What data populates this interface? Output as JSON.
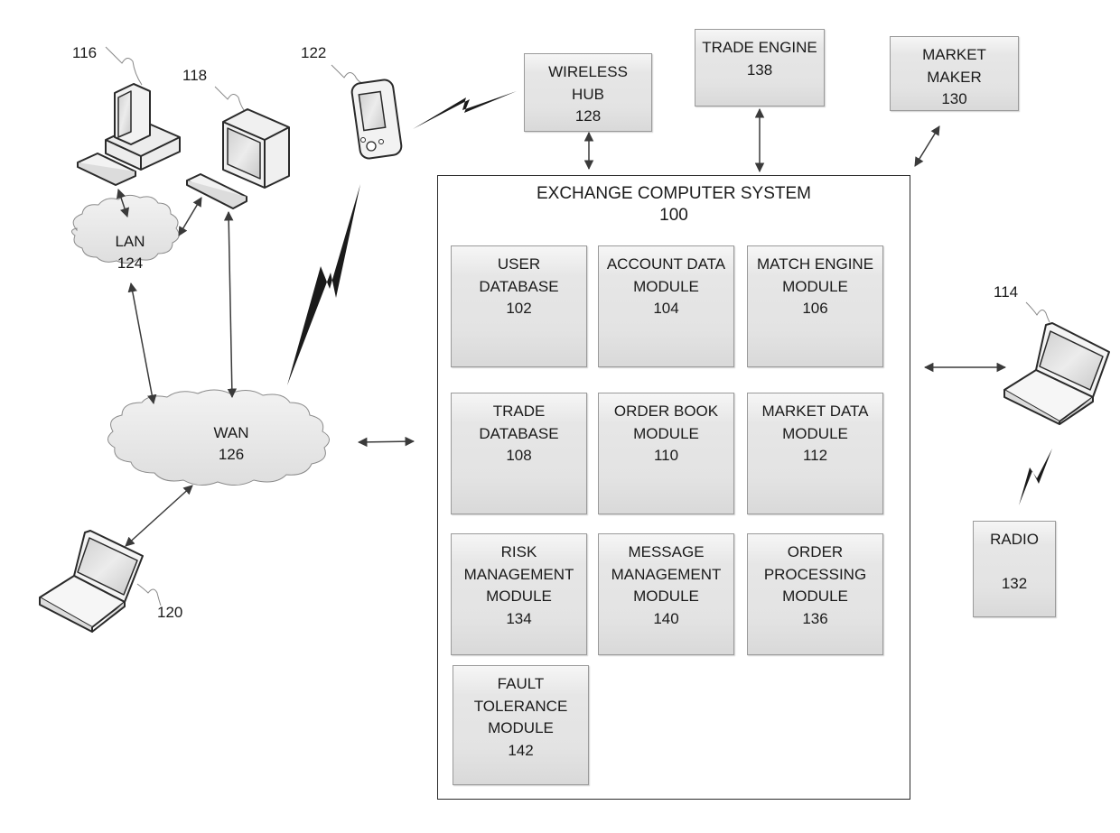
{
  "exchange": {
    "title": "EXCHANGE COMPUTER SYSTEM",
    "ref": "100",
    "modules": [
      {
        "lines": [
          "USER",
          "DATABASE"
        ],
        "ref": "102"
      },
      {
        "lines": [
          "ACCOUNT DATA",
          "MODULE"
        ],
        "ref": "104"
      },
      {
        "lines": [
          "MATCH ENGINE",
          "MODULE"
        ],
        "ref": "106"
      },
      {
        "lines": [
          "TRADE",
          "DATABASE"
        ],
        "ref": "108"
      },
      {
        "lines": [
          "ORDER BOOK",
          "MODULE"
        ],
        "ref": "110"
      },
      {
        "lines": [
          "MARKET DATA",
          "MODULE"
        ],
        "ref": "112"
      },
      {
        "lines": [
          "RISK",
          "MANAGEMENT",
          "MODULE"
        ],
        "ref": "134"
      },
      {
        "lines": [
          "MESSAGE",
          "MANAGEMENT",
          "MODULE"
        ],
        "ref": "140"
      },
      {
        "lines": [
          "ORDER",
          "PROCESSING",
          "MODULE"
        ],
        "ref": "136"
      },
      {
        "lines": [
          "FAULT",
          "TOLERANCE",
          "MODULE"
        ],
        "ref": "142"
      }
    ]
  },
  "external_boxes": {
    "wireless_hub": {
      "lines": [
        "WIRELESS",
        "HUB"
      ],
      "ref": "128"
    },
    "trade_engine": {
      "lines": [
        "TRADE ENGINE"
      ],
      "ref": "138"
    },
    "market_maker": {
      "lines": [
        "MARKET",
        "MAKER"
      ],
      "ref": "130"
    },
    "radio": {
      "lines": [
        "RADIO",
        ""
      ],
      "ref": "132"
    }
  },
  "networks": {
    "lan": {
      "label": "LAN",
      "ref": "124"
    },
    "wan": {
      "label": "WAN",
      "ref": "126"
    }
  },
  "devices": {
    "desktop_116": {
      "ref": "116",
      "icon": "desktop-computer-icon"
    },
    "workstation_118": {
      "ref": "118",
      "icon": "monitor-computer-icon"
    },
    "pda_122": {
      "ref": "122",
      "icon": "pda-icon"
    },
    "laptop_114": {
      "ref": "114",
      "icon": "laptop-icon"
    },
    "laptop_120": {
      "ref": "120",
      "icon": "laptop-icon"
    }
  }
}
